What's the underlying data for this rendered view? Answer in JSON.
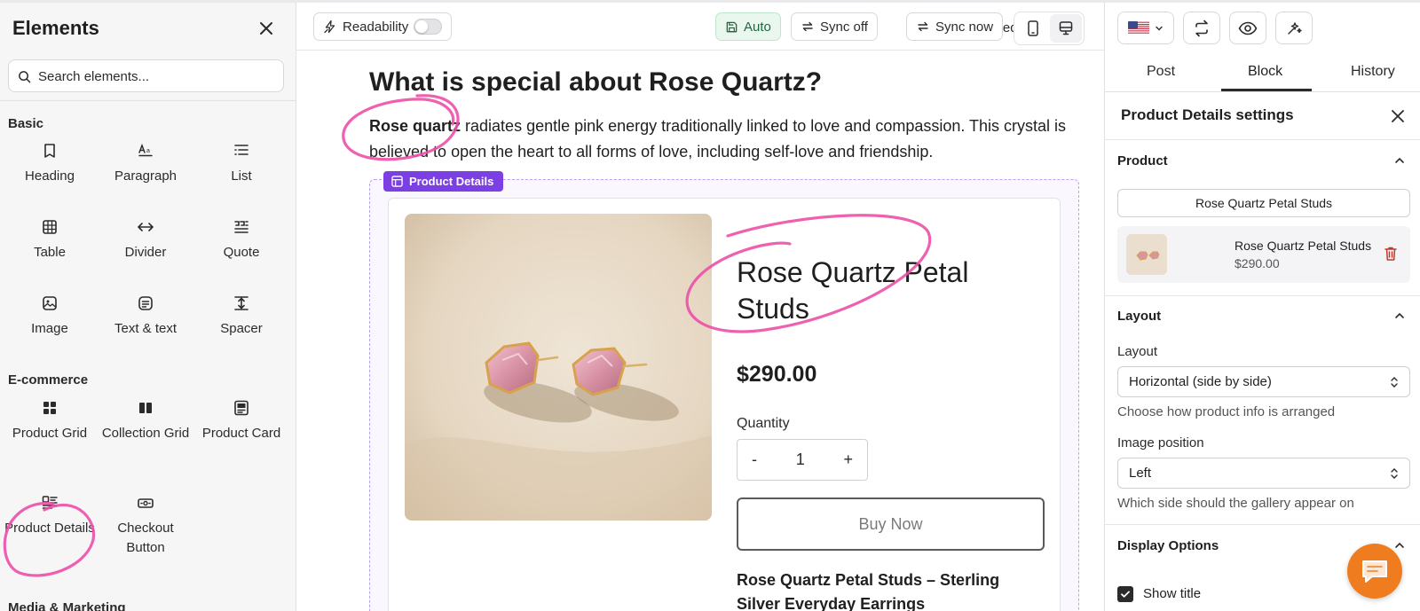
{
  "left": {
    "title": "Elements",
    "search_placeholder": "Search elements...",
    "sections": {
      "basic": "Basic",
      "ecommerce": "E-commerce",
      "media": "Media & Marketing"
    },
    "basic_items": [
      {
        "label": "Heading",
        "icon": "bookmark-icon"
      },
      {
        "label": "Paragraph",
        "icon": "paragraph-icon"
      },
      {
        "label": "List",
        "icon": "list-icon"
      },
      {
        "label": "Table",
        "icon": "table-icon"
      },
      {
        "label": "Divider",
        "icon": "divider-icon"
      },
      {
        "label": "Quote",
        "icon": "quote-icon"
      },
      {
        "label": "Image",
        "icon": "image-icon"
      },
      {
        "label": "Text & text",
        "icon": "text-icon"
      },
      {
        "label": "Spacer",
        "icon": "spacer-icon"
      }
    ],
    "ecommerce_items": [
      {
        "label": "Product Grid",
        "icon": "grid-icon"
      },
      {
        "label": "Collection Grid",
        "icon": "collection-icon"
      },
      {
        "label": "Product Card",
        "icon": "card-icon"
      },
      {
        "label": "Product Details",
        "icon": "details-icon"
      },
      {
        "label": "Checkout Button",
        "icon": "checkout-icon"
      }
    ]
  },
  "toolbar": {
    "readability": "Readability",
    "saved": "Saved",
    "auto": "Auto",
    "sync_off": "Sync off",
    "sync_now": "Sync now"
  },
  "canvas": {
    "heading": "What is special about Rose Quartz?",
    "para_bold": "Rose quartz",
    "para_rest": " radiates gentle pink energy traditionally linked to love and compassion. This crystal is believed to open the heart to all forms of love, including self-love and friendship.",
    "block_tag": "Product Details",
    "product_title": "Rose Quartz Petal Studs",
    "price": "$290.00",
    "quantity_label": "Quantity",
    "qty_minus": "-",
    "qty_value": "1",
    "qty_plus": "+",
    "buy_label": "Buy Now",
    "subheading": "Rose Quartz Petal Studs – Sterling Silver Everyday Earrings"
  },
  "right": {
    "tabs": [
      "Post",
      "Block",
      "History"
    ],
    "active_tab": "Block",
    "settings_title": "Product Details settings",
    "product_section": "Product",
    "product_button": "Rose Quartz Petal Studs",
    "selected_product": {
      "name": "Rose Quartz Petal Studs",
      "price": "$290.00"
    },
    "layout_section": "Layout",
    "layout_label": "Layout",
    "layout_value": "Horizontal (side by side)",
    "layout_help": "Choose how product info is arranged",
    "image_position_label": "Image position",
    "image_position_value": "Left",
    "image_position_help": "Which side should the gallery appear on",
    "display_section": "Display Options",
    "show_title_label": "Show title",
    "show_title_checked": true
  },
  "colors": {
    "accent": "#7b3fe4",
    "annotation": "#ec4fa7",
    "chat": "#ef7d1f",
    "saved_green": "#1c6b3d"
  }
}
